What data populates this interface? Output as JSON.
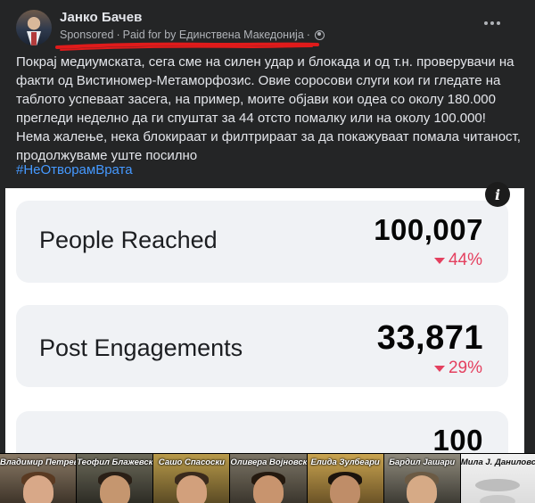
{
  "post": {
    "author": "Јанко Бачев",
    "sponsored_label": "Sponsored",
    "paid_for": "Paid for by Единствена Македонија",
    "separator": "·",
    "body": "Покрај медиумската, сега сме на силен удар и блокада и од т.н. проверувачи на факти од Вистиномер-Метаморфозис. Овие соросови слуги кои ги гледате на таблото успеваат засега, на пример, моите објави кои одеа со околу 180.000 прегледи неделно да ги спуштат за 44 отсто помалку или на околу 100.000! Нема жалење, нека блокираат и филтрираат за да покажуваат помала читаност, продолжуваме уште посилно",
    "hashtag": "#НеОтворамВрата"
  },
  "stats": [
    {
      "label": "People Reached",
      "value": "100,007",
      "change": "44%"
    },
    {
      "label": "Post Engagements",
      "value": "33,871",
      "change": "29%"
    },
    {
      "label": "",
      "value": "100",
      "change": ""
    }
  ],
  "strip": {
    "names": [
      "Владимир Петревски",
      "Теофил Блажевски",
      "Сашо Спасоски",
      "Оливера Војновска",
      "Елида Зулбеари",
      "Бардил Јашари",
      "Мила Ј. Даниловска"
    ]
  },
  "colors": {
    "background": "#242526",
    "text": "#e4e6eb",
    "meta_text": "#b0b3b8",
    "hashtag": "#4599ff",
    "decrease": "#e4405f",
    "annotation_underline": "#e01b1b"
  },
  "icons": {
    "privacy": "globe-icon",
    "menu": "more-horizontal-icon",
    "info": "info-icon",
    "change": "down-arrow-icon"
  }
}
